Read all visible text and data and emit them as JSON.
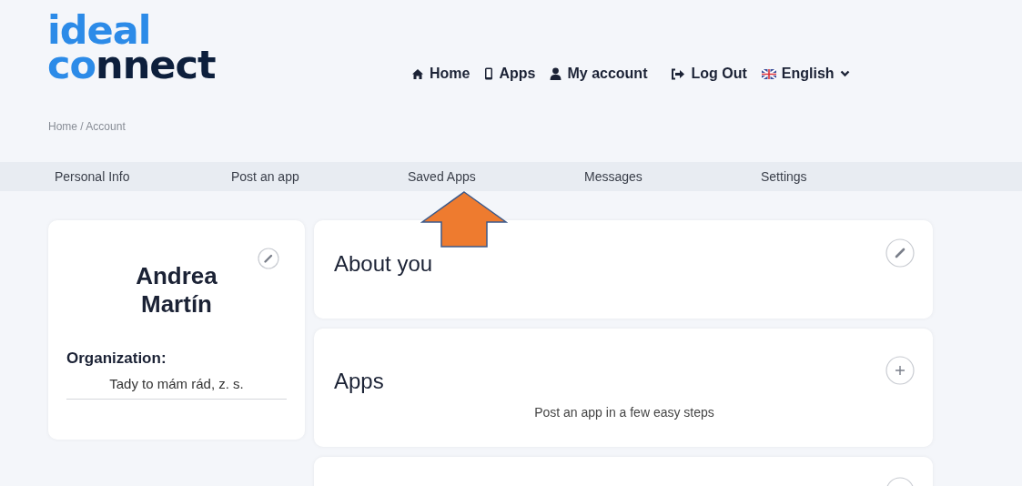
{
  "logo": {
    "line1": "ideal",
    "line2": "connect"
  },
  "nav": [
    {
      "label": "Home",
      "kind": "link"
    },
    {
      "label": "Apps",
      "kind": "link"
    },
    {
      "label": "My account",
      "kind": "link"
    },
    {
      "label": "Log Out",
      "kind": "link"
    },
    {
      "label": "English",
      "kind": "dropdown"
    }
  ],
  "breadcrumb": "Home / Account",
  "tabs": [
    {
      "label": "Personal Info",
      "selected": false
    },
    {
      "label": "Post an app",
      "selected": false
    },
    {
      "label": "Saved Apps",
      "selected": false
    },
    {
      "label": "Messages",
      "selected": false
    },
    {
      "label": "Settings",
      "selected": false
    }
  ],
  "profile": {
    "name": "Andrea Martín",
    "organization_label": "Organization:",
    "organization": "Tady to mám rád, z. s."
  },
  "sections": [
    {
      "title": "About you",
      "kind": "edit"
    },
    {
      "title": "Apps",
      "kind": "add",
      "text": "Post an app in a few easy steps"
    }
  ]
}
